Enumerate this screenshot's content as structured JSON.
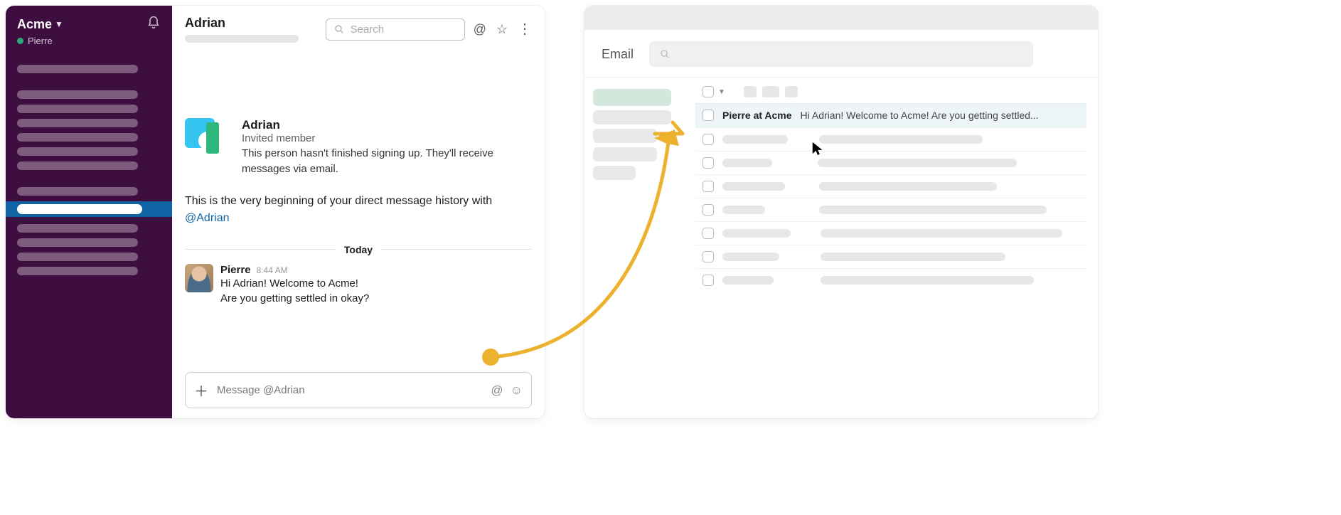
{
  "slack": {
    "workspace_name": "Acme",
    "current_user": "Pierre",
    "header": {
      "channel_name": "Adrian",
      "search_placeholder": "Search"
    },
    "dm_intro": {
      "name": "Adrian",
      "role": "Invited member",
      "note": "This person hasn't finished signing up. They'll receive messages via email.",
      "beginning_prefix": "This is the very beginning of your direct message history with ",
      "mention": "@Adrian"
    },
    "date_divider": "Today",
    "message": {
      "author": "Pierre",
      "time": "8:44 AM",
      "line1": "Hi Adrian! Welcome to Acme!",
      "line2": "Are you getting settled in okay?"
    },
    "composer_placeholder": "Message @Adrian"
  },
  "email": {
    "title": "Email",
    "row": {
      "sender": "Pierre at Acme",
      "subject": "Hi Adrian! Welcome to Acme! Are you getting settled..."
    }
  },
  "colors": {
    "slack_purple": "#3f0e40",
    "slack_active_blue": "#1164a3",
    "arrow_gold": "#ecb22e"
  }
}
